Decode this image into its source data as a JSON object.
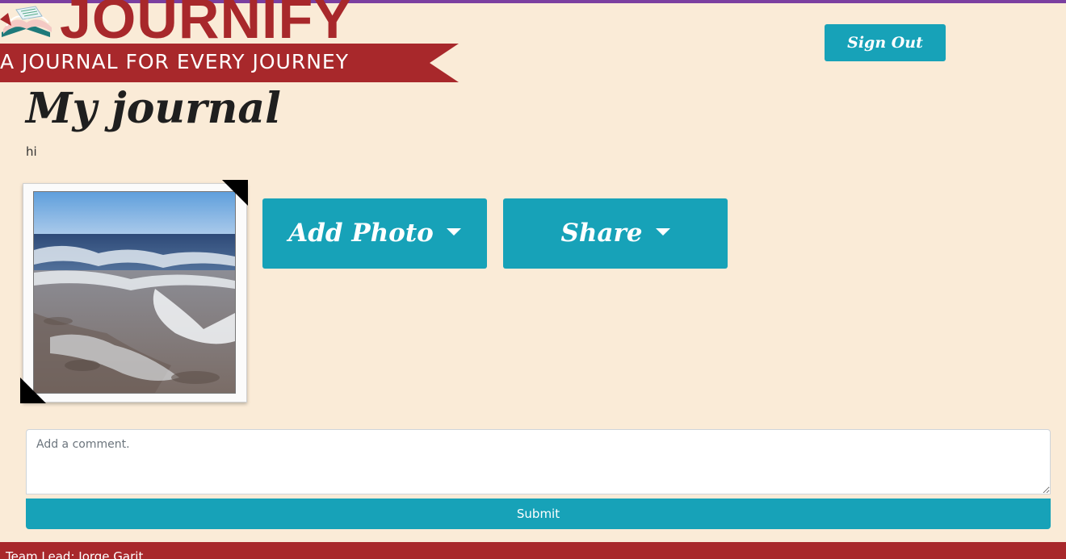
{
  "header": {
    "logo_text": "JOURNIFY",
    "tagline": "A JOURNAL FOR EVERY JOURNEY",
    "sign_out_label": "Sign Out"
  },
  "journal": {
    "title": "My journal",
    "description": "hi"
  },
  "actions": {
    "add_photo_label": "Add Photo",
    "share_label": "Share"
  },
  "comment": {
    "placeholder": "Add a comment.",
    "value": "",
    "submit_label": "Submit"
  },
  "footer": {
    "text": "Team Lead: Jorge Garit"
  },
  "colors": {
    "background": "#faebd7",
    "brand_red": "#a8282b",
    "accent_teal": "#17a2b8",
    "top_stripe": "#7b3fa0"
  },
  "icons": {
    "logo": "open-book-icon",
    "dropdown": "caret-down-icon"
  }
}
